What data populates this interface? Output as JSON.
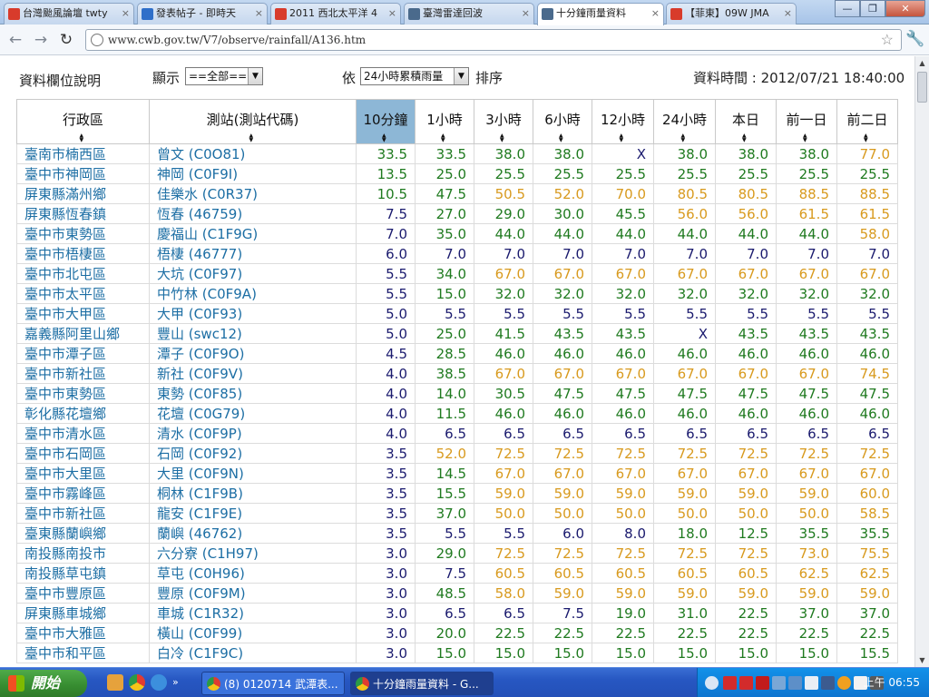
{
  "browser": {
    "tabs": [
      {
        "label": "台灣颱風論壇 twty",
        "icon_color": "#d83b2b",
        "active": false
      },
      {
        "label": "發表帖子 - 即時天",
        "icon_color": "#2f6fc9",
        "active": false
      },
      {
        "label": "2011 西北太平洋 4",
        "icon_color": "#d83b2b",
        "active": false
      },
      {
        "label": "臺灣雷達回波",
        "icon_color": "#4a6a8c",
        "active": false
      },
      {
        "label": "十分鐘雨量資料",
        "icon_color": "#4a6a8c",
        "active": true
      },
      {
        "label": "【菲東】09W JMA",
        "icon_color": "#d83b2b",
        "active": false
      }
    ],
    "tab_close": "×",
    "window_controls": {
      "minimize": "—",
      "restore": "❐",
      "close": "✕"
    },
    "url": "www.cwb.gov.tw/V7/observe/rainfall/A136.htm",
    "nav": {
      "back": "←",
      "forward": "→",
      "reload": "↻",
      "star": "☆",
      "wrench": "🔧"
    }
  },
  "page": {
    "legend_link": "資料欄位說明",
    "display_label": "顯示",
    "display_select": "==全部==",
    "by_label": "依",
    "sort_select": "24小時累積雨量",
    "sort_label": "排序",
    "data_time": "資料時間 : 2012/07/21 18:40:00",
    "sorted_column_color": "#8db7d6",
    "color_low": "#1a1a6e",
    "color_mid": "#1f7a1f",
    "color_high": "#d89a1e"
  },
  "table": {
    "headers": [
      "行政區",
      "測站(測站代碼)",
      "10分鐘",
      "1小時",
      "3小時",
      "6小時",
      "12小時",
      "24小時",
      "本日",
      "前一日",
      "前二日"
    ],
    "sorted_column": 2,
    "rows": [
      [
        "臺南市楠西區",
        "曾文 (C0O81)",
        "33.5",
        "33.5",
        "38.0",
        "38.0",
        "X",
        "38.0",
        "38.0",
        "38.0",
        "77.0"
      ],
      [
        "臺中市神岡區",
        "神岡 (C0F9I)",
        "13.5",
        "25.0",
        "25.5",
        "25.5",
        "25.5",
        "25.5",
        "25.5",
        "25.5",
        "25.5"
      ],
      [
        "屏東縣滿州鄉",
        "佳樂水 (C0R37)",
        "10.5",
        "47.5",
        "50.5",
        "52.0",
        "70.0",
        "80.5",
        "80.5",
        "88.5",
        "88.5"
      ],
      [
        "屏東縣恆春鎮",
        "恆春 (46759)",
        "7.5",
        "27.0",
        "29.0",
        "30.0",
        "45.5",
        "56.0",
        "56.0",
        "61.5",
        "61.5"
      ],
      [
        "臺中市東勢區",
        "慶福山 (C1F9G)",
        "7.0",
        "35.0",
        "44.0",
        "44.0",
        "44.0",
        "44.0",
        "44.0",
        "44.0",
        "58.0"
      ],
      [
        "臺中市梧棲區",
        "梧棲 (46777)",
        "6.0",
        "7.0",
        "7.0",
        "7.0",
        "7.0",
        "7.0",
        "7.0",
        "7.0",
        "7.0"
      ],
      [
        "臺中市北屯區",
        "大坑 (C0F97)",
        "5.5",
        "34.0",
        "67.0",
        "67.0",
        "67.0",
        "67.0",
        "67.0",
        "67.0",
        "67.0"
      ],
      [
        "臺中市太平區",
        "中竹林 (C0F9A)",
        "5.5",
        "15.0",
        "32.0",
        "32.0",
        "32.0",
        "32.0",
        "32.0",
        "32.0",
        "32.0"
      ],
      [
        "臺中市大甲區",
        "大甲 (C0F93)",
        "5.0",
        "5.5",
        "5.5",
        "5.5",
        "5.5",
        "5.5",
        "5.5",
        "5.5",
        "5.5"
      ],
      [
        "嘉義縣阿里山鄉",
        "豐山 (swc12)",
        "5.0",
        "25.0",
        "41.5",
        "43.5",
        "43.5",
        "X",
        "43.5",
        "43.5",
        "43.5"
      ],
      [
        "臺中市潭子區",
        "潭子 (C0F9O)",
        "4.5",
        "28.5",
        "46.0",
        "46.0",
        "46.0",
        "46.0",
        "46.0",
        "46.0",
        "46.0"
      ],
      [
        "臺中市新社區",
        "新社 (C0F9V)",
        "4.0",
        "38.5",
        "67.0",
        "67.0",
        "67.0",
        "67.0",
        "67.0",
        "67.0",
        "74.5"
      ],
      [
        "臺中市東勢區",
        "東勢 (C0F85)",
        "4.0",
        "14.0",
        "30.5",
        "47.5",
        "47.5",
        "47.5",
        "47.5",
        "47.5",
        "47.5"
      ],
      [
        "彰化縣花壇鄉",
        "花壇 (C0G79)",
        "4.0",
        "11.5",
        "46.0",
        "46.0",
        "46.0",
        "46.0",
        "46.0",
        "46.0",
        "46.0"
      ],
      [
        "臺中市清水區",
        "清水 (C0F9P)",
        "4.0",
        "6.5",
        "6.5",
        "6.5",
        "6.5",
        "6.5",
        "6.5",
        "6.5",
        "6.5"
      ],
      [
        "臺中市石岡區",
        "石岡 (C0F92)",
        "3.5",
        "52.0",
        "72.5",
        "72.5",
        "72.5",
        "72.5",
        "72.5",
        "72.5",
        "72.5"
      ],
      [
        "臺中市大里區",
        "大里 (C0F9N)",
        "3.5",
        "14.5",
        "67.0",
        "67.0",
        "67.0",
        "67.0",
        "67.0",
        "67.0",
        "67.0"
      ],
      [
        "臺中市霧峰區",
        "桐林 (C1F9B)",
        "3.5",
        "15.5",
        "59.0",
        "59.0",
        "59.0",
        "59.0",
        "59.0",
        "59.0",
        "60.0"
      ],
      [
        "臺中市新社區",
        "龍安 (C1F9E)",
        "3.5",
        "37.0",
        "50.0",
        "50.0",
        "50.0",
        "50.0",
        "50.0",
        "50.0",
        "58.5"
      ],
      [
        "臺東縣蘭嶼鄉",
        "蘭嶼 (46762)",
        "3.5",
        "5.5",
        "5.5",
        "6.0",
        "8.0",
        "18.0",
        "12.5",
        "35.5",
        "35.5"
      ],
      [
        "南投縣南投市",
        "六分寮 (C1H97)",
        "3.0",
        "29.0",
        "72.5",
        "72.5",
        "72.5",
        "72.5",
        "72.5",
        "73.0",
        "75.5"
      ],
      [
        "南投縣草屯鎮",
        "草屯 (C0H96)",
        "3.0",
        "7.5",
        "60.5",
        "60.5",
        "60.5",
        "60.5",
        "60.5",
        "62.5",
        "62.5"
      ],
      [
        "臺中市豐原區",
        "豐原 (C0F9M)",
        "3.0",
        "48.5",
        "58.0",
        "59.0",
        "59.0",
        "59.0",
        "59.0",
        "59.0",
        "59.0"
      ],
      [
        "屏東縣車城鄉",
        "車城 (C1R32)",
        "3.0",
        "6.5",
        "6.5",
        "7.5",
        "19.0",
        "31.0",
        "22.5",
        "37.0",
        "37.0"
      ],
      [
        "臺中市大雅區",
        "橫山 (C0F99)",
        "3.0",
        "20.0",
        "22.5",
        "22.5",
        "22.5",
        "22.5",
        "22.5",
        "22.5",
        "22.5"
      ],
      [
        "臺中市和平區",
        "白冷 (C1F9C)",
        "3.0",
        "15.0",
        "15.0",
        "15.0",
        "15.0",
        "15.0",
        "15.0",
        "15.0",
        "15.5"
      ]
    ]
  },
  "taskbar": {
    "start_label": "開始",
    "tasks": [
      {
        "label": "(8) 0120714 武潭表...",
        "active": false
      },
      {
        "label": "十分鐘雨量資料 - G...",
        "active": true
      }
    ],
    "clock": "上午 06:55"
  }
}
